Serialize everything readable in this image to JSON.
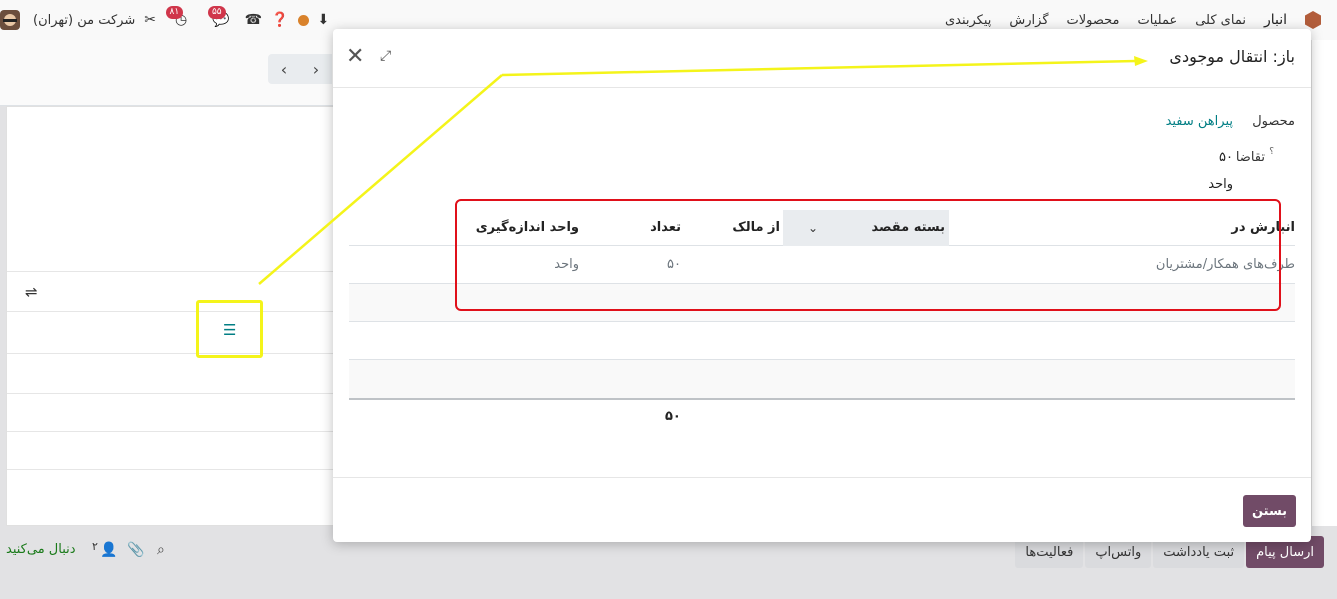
{
  "topbar": {
    "company": "شرکت من (تهران)",
    "badge_activities": "۸۱",
    "badge_messages": "۵۵",
    "app_name": "انبار",
    "menu": [
      "نمای کلی",
      "عملیات",
      "محصولات",
      "گزارش",
      "پیکربندی"
    ]
  },
  "chatter": {
    "follow": "دنبال می‌کنید",
    "followers": "۲",
    "actions": [
      "ارسال پیام",
      "ثبت یادداشت",
      "واتس‌اپ",
      "فعالیت‌ها"
    ]
  },
  "dialog": {
    "title": "باز: انتقال موجودی",
    "product_label": "محصول",
    "product_value": "پیراهن سفید",
    "demand_label": "تقاضا",
    "demand_help": "؟",
    "demand_value": "۵۰",
    "demand_unit": "واحد",
    "columns": {
      "stored_in": "انبارش در",
      "dest_package": "بسته مقصد",
      "owner": "از مالک",
      "quantity": "تعداد",
      "uom": "واحد اندازه‌گیری"
    },
    "rows": [
      {
        "stored_in": "طرف‌های همکار/مشتریان",
        "quantity": "۵۰",
        "uom": "واحد"
      }
    ],
    "total_quantity": "۵۰",
    "close_label": "بستن"
  },
  "colors": {
    "primary": "#714b67",
    "link": "#017e84",
    "annotation_yellow": "#f4f41a",
    "annotation_red": "#e0101a"
  }
}
